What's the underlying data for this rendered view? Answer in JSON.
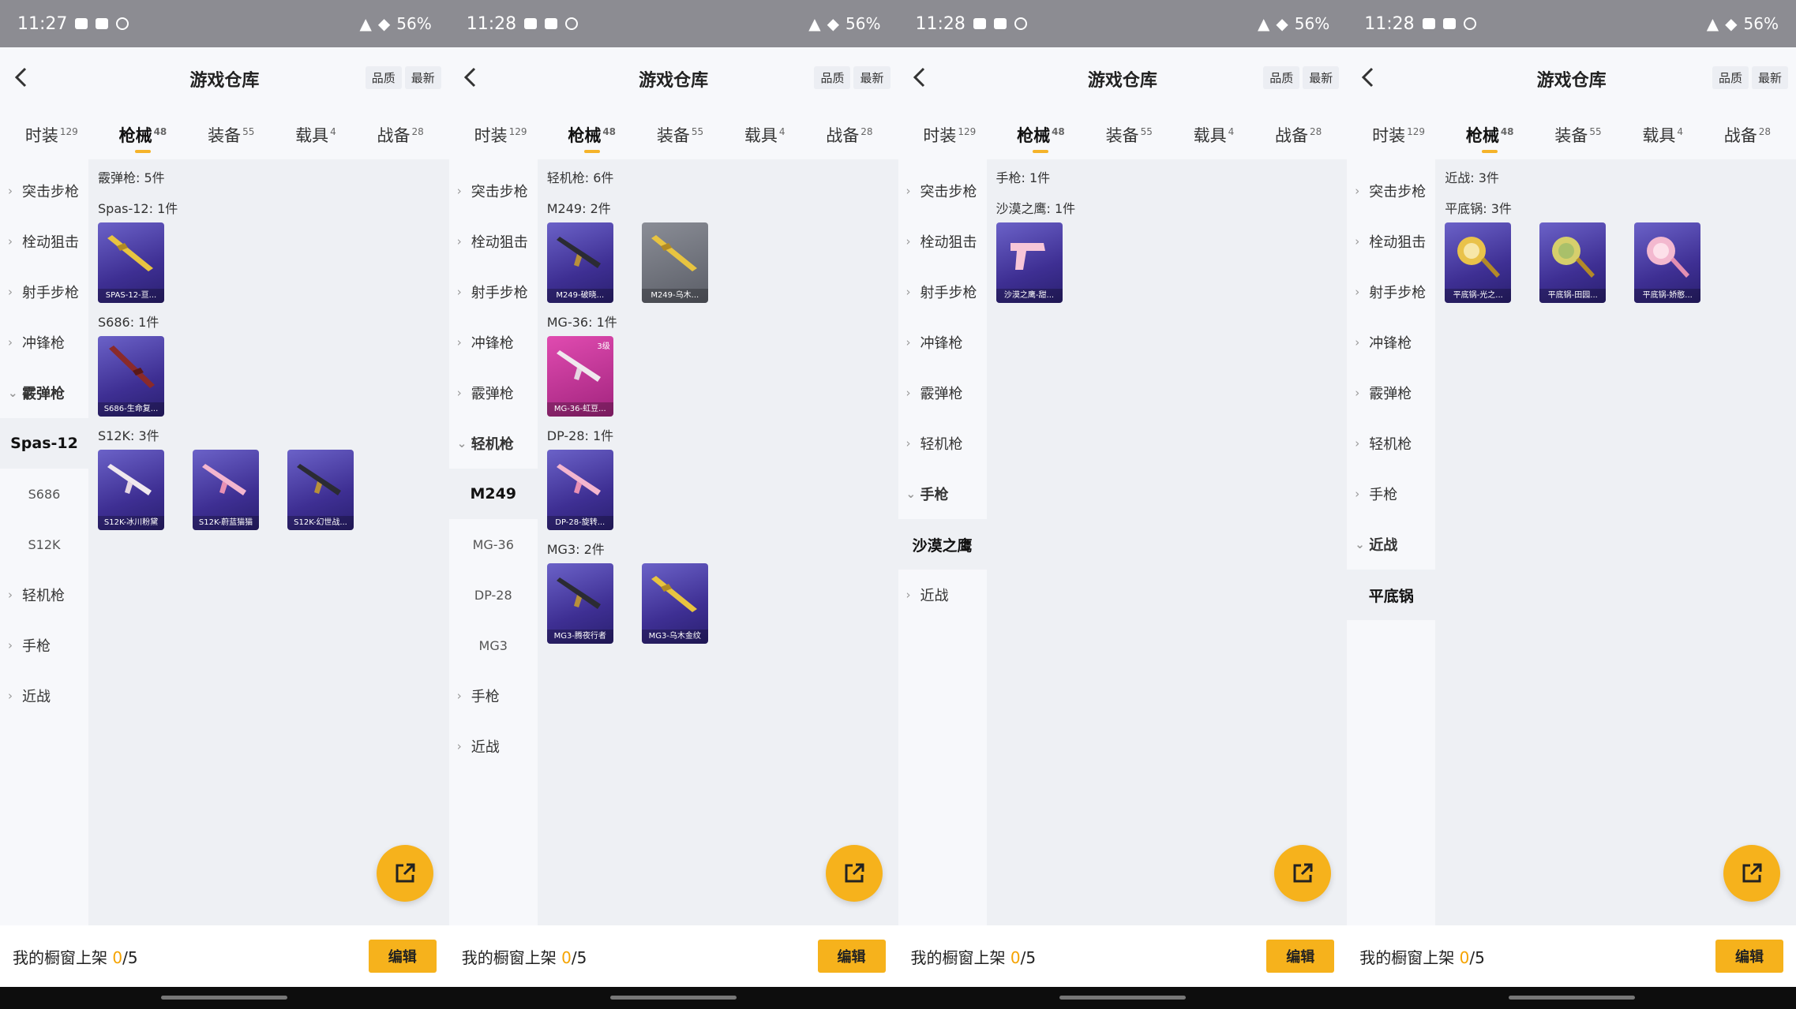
{
  "screens": [
    {
      "status": {
        "time": "11:27",
        "battery": "56%"
      },
      "header": {
        "title": "游戏仓库",
        "sort_quality": "品质",
        "sort_latest": "最新"
      },
      "tabs": [
        {
          "label": "时装",
          "count": "129",
          "active": false
        },
        {
          "label": "枪械",
          "count": "48",
          "active": true
        },
        {
          "label": "装备",
          "count": "55",
          "active": false
        },
        {
          "label": "载具",
          "count": "4",
          "active": false
        },
        {
          "label": "战备",
          "count": "28",
          "active": false
        }
      ],
      "sidebar": [
        {
          "kind": "cat",
          "label": "突击步枪",
          "open": false
        },
        {
          "kind": "cat",
          "label": "栓动狙击",
          "open": false
        },
        {
          "kind": "cat",
          "label": "射手步枪",
          "open": false
        },
        {
          "kind": "cat",
          "label": "冲锋枪",
          "open": false
        },
        {
          "kind": "cat",
          "label": "霰弹枪",
          "open": true
        },
        {
          "kind": "sub",
          "label": "Spas-12",
          "active": true
        },
        {
          "kind": "sub",
          "label": "S686",
          "active": false
        },
        {
          "kind": "sub",
          "label": "S12K",
          "active": false
        },
        {
          "kind": "cat",
          "label": "轻机枪",
          "open": false
        },
        {
          "kind": "cat",
          "label": "手枪",
          "open": false
        },
        {
          "kind": "cat",
          "label": "近战",
          "open": false
        }
      ],
      "content": {
        "section_title": "霰弹枪: 5件",
        "groups": [
          {
            "label": "Spas-12: 1件",
            "items": [
              {
                "name": "SPAS-12-亘...",
                "color": "purple",
                "tag": "",
                "art": "gold"
              }
            ]
          },
          {
            "label": "S686: 1件",
            "items": [
              {
                "name": "S686-生命复...",
                "color": "purple",
                "tag": "",
                "art": "red"
              }
            ]
          },
          {
            "label": "S12K: 3件",
            "items": [
              {
                "name": "S12K-冰川粉黛",
                "color": "purple",
                "tag": "",
                "art": "white"
              },
              {
                "name": "S12K-蔚蓝猫猫",
                "color": "purple",
                "tag": "",
                "art": "pink"
              },
              {
                "name": "S12K-幻世战...",
                "color": "purple",
                "tag": "",
                "art": "dark"
              }
            ]
          }
        ]
      },
      "bottom": {
        "shelf_label": "我的橱窗上架",
        "shelf_count": "0",
        "shelf_total": "/5",
        "edit_label": "编辑"
      }
    },
    {
      "status": {
        "time": "11:28",
        "battery": "56%"
      },
      "header": {
        "title": "游戏仓库",
        "sort_quality": "品质",
        "sort_latest": "最新"
      },
      "tabs": [
        {
          "label": "时装",
          "count": "129",
          "active": false
        },
        {
          "label": "枪械",
          "count": "48",
          "active": true
        },
        {
          "label": "装备",
          "count": "55",
          "active": false
        },
        {
          "label": "载具",
          "count": "4",
          "active": false
        },
        {
          "label": "战备",
          "count": "28",
          "active": false
        }
      ],
      "sidebar": [
        {
          "kind": "cat",
          "label": "突击步枪",
          "open": false
        },
        {
          "kind": "cat",
          "label": "栓动狙击",
          "open": false
        },
        {
          "kind": "cat",
          "label": "射手步枪",
          "open": false
        },
        {
          "kind": "cat",
          "label": "冲锋枪",
          "open": false
        },
        {
          "kind": "cat",
          "label": "霰弹枪",
          "open": false
        },
        {
          "kind": "cat",
          "label": "轻机枪",
          "open": true
        },
        {
          "kind": "sub",
          "label": "M249",
          "active": true
        },
        {
          "kind": "sub",
          "label": "MG-36",
          "active": false
        },
        {
          "kind": "sub",
          "label": "DP-28",
          "active": false
        },
        {
          "kind": "sub",
          "label": "MG3",
          "active": false
        },
        {
          "kind": "cat",
          "label": "手枪",
          "open": false
        },
        {
          "kind": "cat",
          "label": "近战",
          "open": false
        }
      ],
      "content": {
        "section_title": "轻机枪: 6件",
        "groups": [
          {
            "label": "M249: 2件",
            "items": [
              {
                "name": "M249-破晓...",
                "color": "purple",
                "tag": "",
                "art": "dark"
              },
              {
                "name": "M249-乌木...",
                "color": "gray",
                "tag": "",
                "art": "gold"
              }
            ]
          },
          {
            "label": "MG-36: 1件",
            "items": [
              {
                "name": "MG-36-虹豆...",
                "color": "pink",
                "tag": "3级",
                "art": "white"
              }
            ]
          },
          {
            "label": "DP-28: 1件",
            "items": [
              {
                "name": "DP-28-旋转...",
                "color": "purple",
                "tag": "",
                "art": "pink"
              }
            ]
          },
          {
            "label": "MG3: 2件",
            "items": [
              {
                "name": "MG3-腾夜行者",
                "color": "purple",
                "tag": "",
                "art": "dark"
              },
              {
                "name": "MG3-乌木金纹",
                "color": "purple",
                "tag": "",
                "art": "gold"
              }
            ]
          }
        ]
      },
      "bottom": {
        "shelf_label": "我的橱窗上架",
        "shelf_count": "0",
        "shelf_total": "/5",
        "edit_label": "编辑"
      }
    },
    {
      "status": {
        "time": "11:28",
        "battery": "56%"
      },
      "header": {
        "title": "游戏仓库",
        "sort_quality": "品质",
        "sort_latest": "最新"
      },
      "tabs": [
        {
          "label": "时装",
          "count": "129",
          "active": false
        },
        {
          "label": "枪械",
          "count": "48",
          "active": true
        },
        {
          "label": "装备",
          "count": "55",
          "active": false
        },
        {
          "label": "载具",
          "count": "4",
          "active": false
        },
        {
          "label": "战备",
          "count": "28",
          "active": false
        }
      ],
      "sidebar": [
        {
          "kind": "cat",
          "label": "突击步枪",
          "open": false
        },
        {
          "kind": "cat",
          "label": "栓动狙击",
          "open": false
        },
        {
          "kind": "cat",
          "label": "射手步枪",
          "open": false
        },
        {
          "kind": "cat",
          "label": "冲锋枪",
          "open": false
        },
        {
          "kind": "cat",
          "label": "霰弹枪",
          "open": false
        },
        {
          "kind": "cat",
          "label": "轻机枪",
          "open": false
        },
        {
          "kind": "cat",
          "label": "手枪",
          "open": true
        },
        {
          "kind": "sub",
          "label": "沙漠之鹰",
          "active": true
        },
        {
          "kind": "cat",
          "label": "近战",
          "open": false
        }
      ],
      "content": {
        "section_title": "手枪: 1件",
        "groups": [
          {
            "label": "沙漠之鹰: 1件",
            "items": [
              {
                "name": "沙漠之鹰-甜...",
                "color": "purple",
                "tag": "",
                "art": "pistol"
              }
            ]
          }
        ]
      },
      "bottom": {
        "shelf_label": "我的橱窗上架",
        "shelf_count": "0",
        "shelf_total": "/5",
        "edit_label": "编辑"
      }
    },
    {
      "status": {
        "time": "11:28",
        "battery": "56%"
      },
      "header": {
        "title": "游戏仓库",
        "sort_quality": "品质",
        "sort_latest": "最新"
      },
      "tabs": [
        {
          "label": "时装",
          "count": "129",
          "active": false
        },
        {
          "label": "枪械",
          "count": "48",
          "active": true
        },
        {
          "label": "装备",
          "count": "55",
          "active": false
        },
        {
          "label": "载具",
          "count": "4",
          "active": false
        },
        {
          "label": "战备",
          "count": "28",
          "active": false
        }
      ],
      "sidebar": [
        {
          "kind": "cat",
          "label": "突击步枪",
          "open": false
        },
        {
          "kind": "cat",
          "label": "栓动狙击",
          "open": false
        },
        {
          "kind": "cat",
          "label": "射手步枪",
          "open": false
        },
        {
          "kind": "cat",
          "label": "冲锋枪",
          "open": false
        },
        {
          "kind": "cat",
          "label": "霰弹枪",
          "open": false
        },
        {
          "kind": "cat",
          "label": "轻机枪",
          "open": false
        },
        {
          "kind": "cat",
          "label": "手枪",
          "open": false
        },
        {
          "kind": "cat",
          "label": "近战",
          "open": true
        },
        {
          "kind": "sub",
          "label": "平底锅",
          "active": true
        }
      ],
      "content": {
        "section_title": "近战: 3件",
        "groups": [
          {
            "label": "平底锅: 3件",
            "items": [
              {
                "name": "平底锅-光之...",
                "color": "purple",
                "tag": "",
                "art": "pan-gold"
              },
              {
                "name": "平底锅-田园...",
                "color": "purple",
                "tag": "",
                "art": "pan-green"
              },
              {
                "name": "平底锅-娇憨...",
                "color": "purple",
                "tag": "",
                "art": "pan-pink"
              }
            ]
          }
        ]
      },
      "bottom": {
        "shelf_label": "我的橱窗上架",
        "shelf_count": "0",
        "shelf_total": "/5",
        "edit_label": "编辑"
      }
    }
  ],
  "colors": {
    "accent": "#f6b21c",
    "statusbar": "#8c8c92",
    "card_purple": "#4a3ca8",
    "card_pink": "#c23396",
    "card_gray": "#6b6e77"
  },
  "icons": {
    "back": "chevron-left-icon",
    "share": "share-external-icon",
    "expand": "chevron-right-icon",
    "collapse": "chevron-down-icon"
  }
}
